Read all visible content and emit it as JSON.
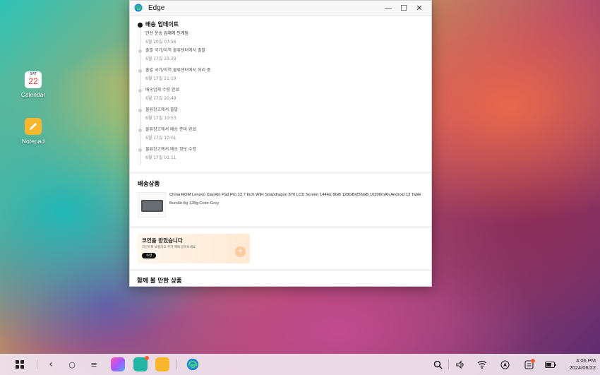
{
  "desktop": {
    "calendar": {
      "label": "Calendar",
      "day": "SAT",
      "date": "22"
    },
    "notepad": {
      "label": "Notepad"
    }
  },
  "window": {
    "title": "Edge",
    "controls": {
      "minimize": "—",
      "maximize": "☐",
      "close": "✕"
    }
  },
  "tracking": {
    "items": [
      {
        "status": "배송 업데이트",
        "sub": "간선 운송 업체에 인계됨",
        "time": "6월 20일 07:56"
      },
      {
        "status": "출발 국가/지역 물류센터에서 출발",
        "time": "6월 17일 23:33"
      },
      {
        "status": "출발 국가/지역 물류센터에서 처리 중",
        "time": "6월 17일 21:19"
      },
      {
        "status": "배송업체 수령 완료",
        "time": "6월 17일 20:49"
      },
      {
        "status": "물류창고에서 출발",
        "time": "6월 17일 10:53"
      },
      {
        "status": "물류창고에서 배송 준비 완료",
        "time": "6월 17일 10:01"
      },
      {
        "status": "물류창고에서 배송 정보 수령",
        "time": "6월 17일 01:11"
      }
    ]
  },
  "product_section": {
    "title": "배송상품",
    "name": "China ROM Lenovo XiaoXin Pad Pro 12.7 Inch WiFi Snapdragon 870 LCD Screen 144Hz 8GB 128GB/256GB 10200mAh Android 13 Table",
    "options": "Bundle:8g 128g;Color:Grey"
  },
  "coin_banner": {
    "title": "코인을 받았습니다",
    "desc": "코인으로 쇼핑하고 추가 혜택 받아보세요",
    "button": "수령",
    "plus": "+"
  },
  "related": {
    "title": "함께 볼 만한 상품"
  },
  "taskbar": {
    "back": "‹",
    "home": "○",
    "menu": "≡",
    "time": "4:06 PM",
    "date": "2024/06/22"
  }
}
